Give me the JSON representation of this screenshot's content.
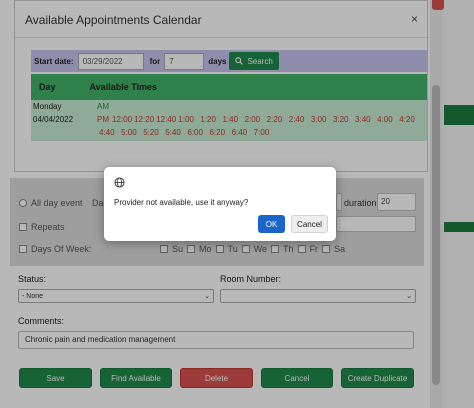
{
  "calendar": {
    "title": "Available Appointments Calendar",
    "close_glyph": "×",
    "start_date_label": "Start date:",
    "start_date_value": "03/29/2022",
    "for_label": "for",
    "days_value": "7",
    "days_label": "days",
    "search_label": "Search",
    "col_day": "Day",
    "col_times": "Available Times",
    "day_name": "Monday",
    "day_date": "04/04/2022",
    "am_label": "AM",
    "pm_label": "PM",
    "times_row1": [
      "12:00",
      "12:20",
      "12:40",
      "1:00",
      "1:20",
      "1:40",
      "2:00",
      "2:20",
      "2:40",
      "3:00",
      "3:20",
      "3:40",
      "4:00",
      "4:20"
    ],
    "times_row2": [
      "4:40",
      "5:00",
      "5:20",
      "5:40",
      "6:00",
      "6:20",
      "6:40",
      "7:00"
    ]
  },
  "form": {
    "all_day_label": "All day event",
    "date_label_partial": "Da",
    "duration_label": "duration",
    "duration_value": "20",
    "repeats_label": "Repeats",
    "days_of_week_label": "Days Of Week:",
    "weekdays": [
      "Su",
      "Mo",
      "Tu",
      "We",
      "Th",
      "Fr",
      "Sa"
    ],
    "status_label": "Status:",
    "status_value": "- None",
    "room_label": "Room Number:",
    "room_value": "",
    "comments_label": "Comments:",
    "comments_value": "Chronic pain and medication management",
    "buttons": {
      "save": "Save",
      "find_available": "Find Available",
      "delete": "Delete",
      "cancel": "Cancel",
      "create_duplicate": "Create Duplicate"
    }
  },
  "alert": {
    "message": "Provider not available, use it anyway?",
    "ok_label": "OK",
    "cancel_label": "Cancel"
  },
  "colors": {
    "primary_green": "#1f8a4c",
    "table_header_green": "#43b26a",
    "table_body_green": "#c8ecd4",
    "danger_red": "#d9534f",
    "ok_blue": "#1b64cc",
    "search_bar_lavender": "#c5c5ef"
  }
}
